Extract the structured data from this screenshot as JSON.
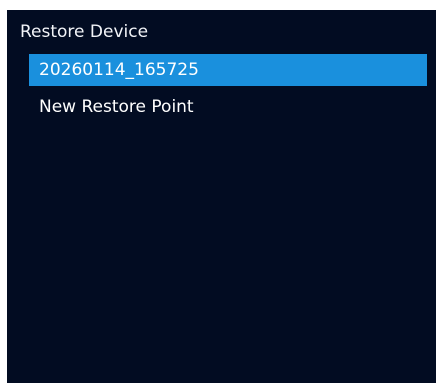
{
  "header": {
    "title": "Restore Device"
  },
  "menu": {
    "items": [
      {
        "label": "20260114_165725",
        "selected": true
      },
      {
        "label": "New Restore Point",
        "selected": false
      }
    ]
  },
  "colors": {
    "background": "#020c22",
    "selection": "#1a90dd",
    "text": "#ffffff"
  }
}
